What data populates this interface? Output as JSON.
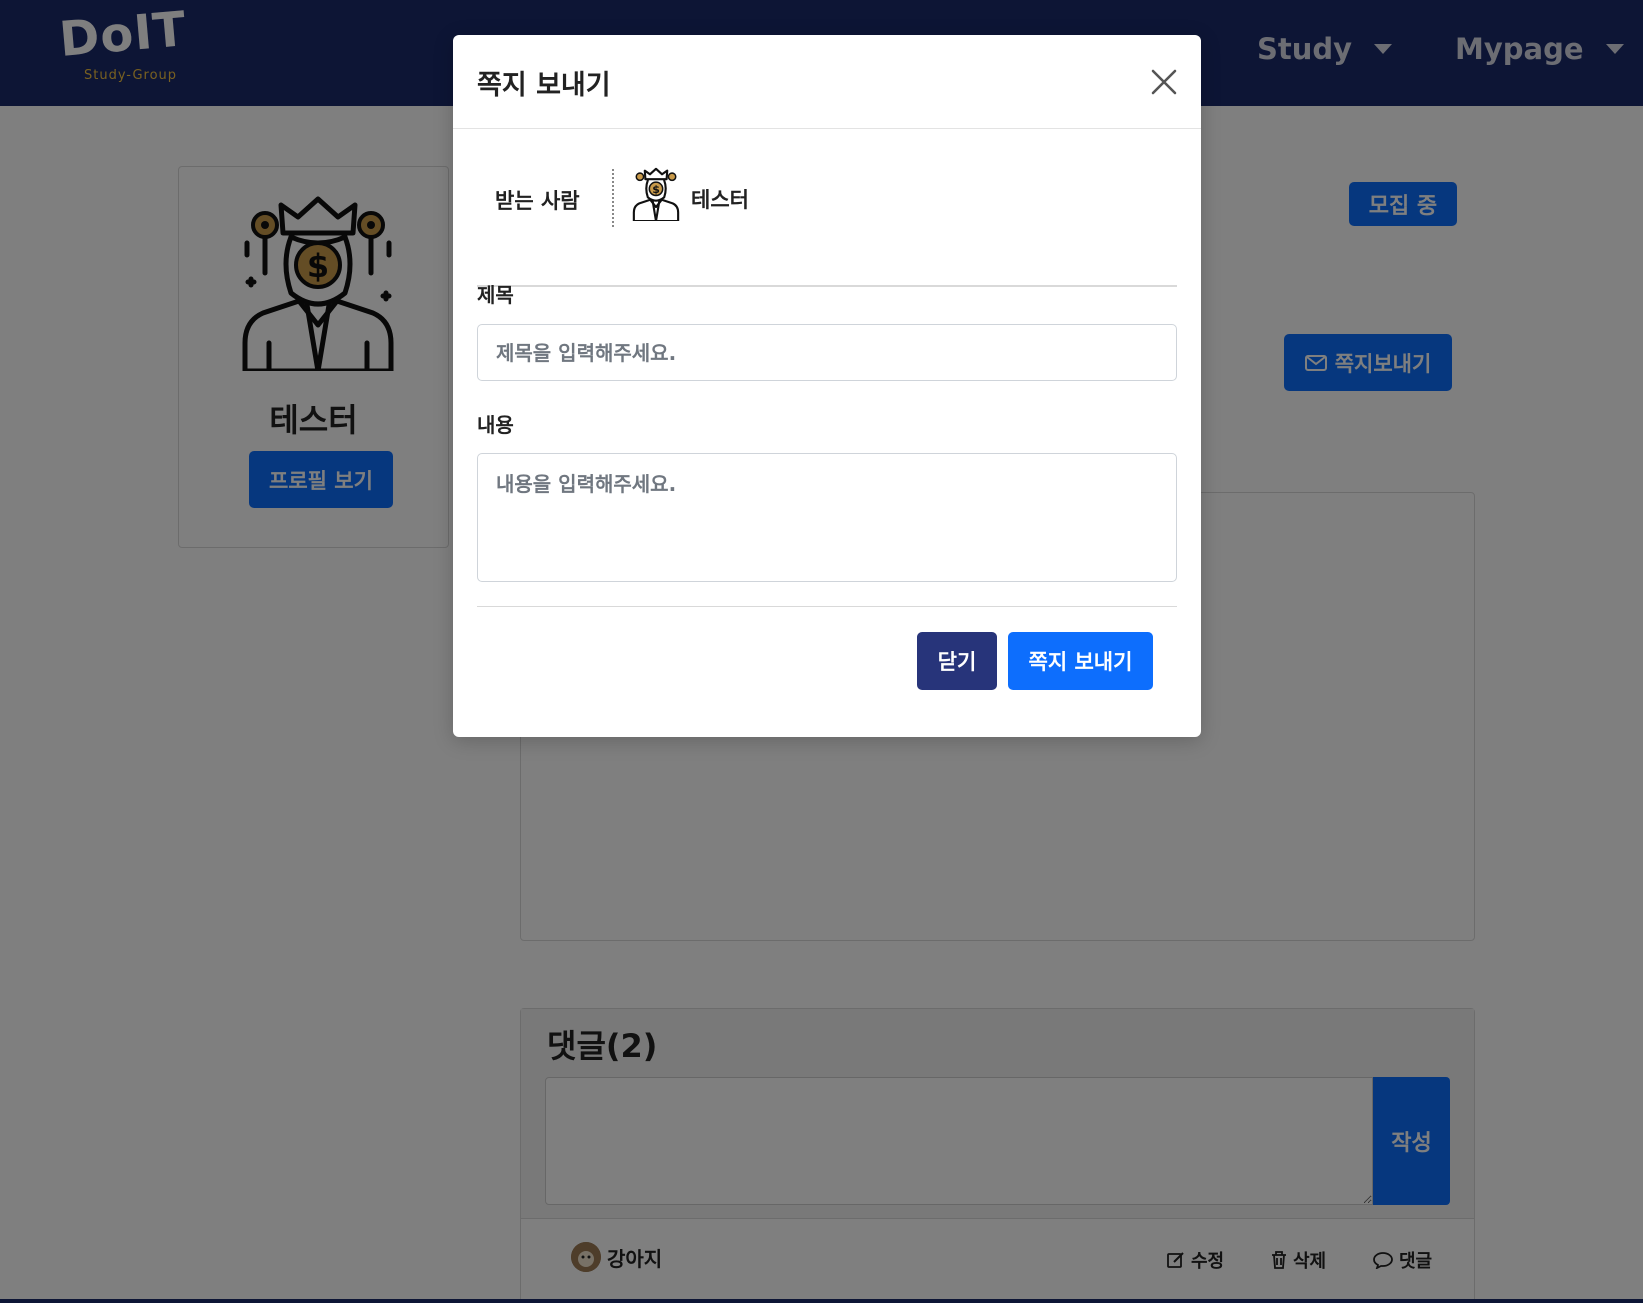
{
  "navbar": {
    "logo": "DoIT",
    "logo_sub": "Study-Group",
    "items": [
      {
        "label": "Study"
      },
      {
        "label": "Mypage"
      }
    ]
  },
  "profile": {
    "name": "테스터",
    "view_button": "프로필 보기"
  },
  "post": {
    "status_badge": "모집 중",
    "message_button": "쪽지보내기"
  },
  "comments": {
    "title": "댓글(2)",
    "submit_label": "작성",
    "items": [
      {
        "author": "강아지",
        "edit": "수정",
        "delete": "삭제",
        "reply": "댓글"
      }
    ]
  },
  "modal": {
    "title": "쪽지 보내기",
    "recipient_label": "받는 사람",
    "recipient_name": "테스터",
    "title_label": "제목",
    "title_placeholder": "제목을 입력해주세요.",
    "title_value": "",
    "body_label": "내용",
    "body_placeholder": "내용을 입력해주세요.",
    "body_value": "",
    "close_button": "닫기",
    "send_button": "쪽지 보내기"
  },
  "colors": {
    "navbar": "#1b2a6b",
    "primary": "#0d6efd",
    "secondary": "#27347a",
    "accent_gold": "#f0c040"
  },
  "icons": {
    "avatar": "money-bag-businessman-icon",
    "close": "close-icon",
    "message": "envelope-icon",
    "edit": "edit-icon",
    "delete": "trash-icon",
    "reply": "speech-bubble-icon"
  }
}
